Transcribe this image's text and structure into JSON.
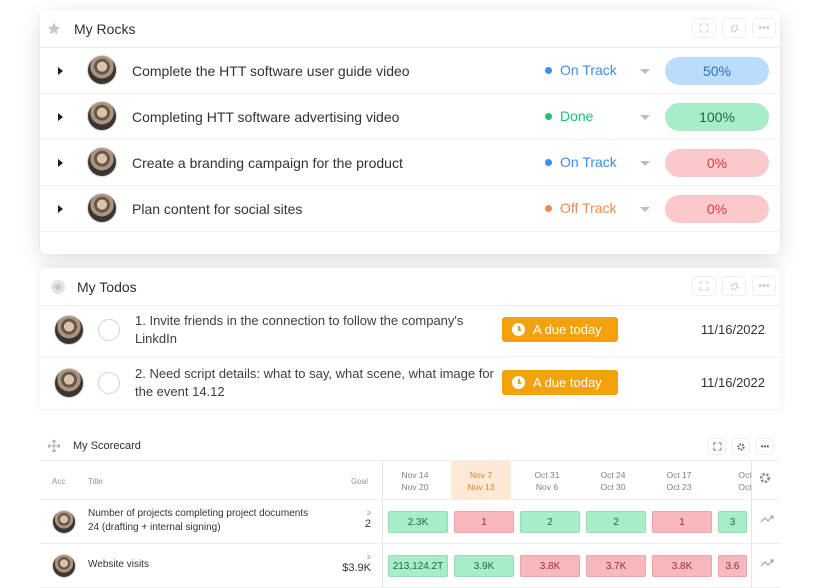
{
  "rocks": {
    "title": "My Rocks",
    "rows": [
      {
        "title": "Complete the HTT software user guide video",
        "status": "On Track",
        "status_color": "#3b8ff0",
        "progress": "50%",
        "pill_bg": "#bcdcfb",
        "pill_fg": "#2a6fc4"
      },
      {
        "title": "Completing HTT software advertising video",
        "status": "Done",
        "status_color": "#16c472",
        "progress": "100%",
        "pill_bg": "#a9ecc8",
        "pill_fg": "#1d6a45"
      },
      {
        "title": "Create a branding campaign for the product",
        "status": "On Track",
        "status_color": "#3b8ff0",
        "progress": "0%",
        "pill_bg": "#fbc9cc",
        "pill_fg": "#d83a45"
      },
      {
        "title": "Plan content for social sites",
        "status": "Off Track",
        "status_color": "#f08a4b",
        "progress": "0%",
        "pill_bg": "#fbc9cc",
        "pill_fg": "#d83a45"
      }
    ]
  },
  "todos": {
    "title": "My Todos",
    "rows": [
      {
        "text": "1. Invite friends in the connection to follow the company's LinkdIn",
        "badge": "A due today",
        "date": "11/16/2022"
      },
      {
        "text": "2. Need script details: what to say, what scene, what image for the event 14.12",
        "badge": "A due today",
        "date": "11/16/2022"
      }
    ]
  },
  "scorecard": {
    "title": "My Scorecard",
    "headers": {
      "acc": "Acc",
      "title": "Title",
      "goal": "Goal"
    },
    "weeks": [
      {
        "a": "Nov 14",
        "b": "Nov 20",
        "current": false
      },
      {
        "a": "Nov 7",
        "b": "Nov 13",
        "current": true
      },
      {
        "a": "Oct 31",
        "b": "Nov 6",
        "current": false
      },
      {
        "a": "Oct 24",
        "b": "Oct 30",
        "current": false
      },
      {
        "a": "Oct 17",
        "b": "Oct 23",
        "current": false
      },
      {
        "a": "Oct",
        "b": "Oct",
        "current": false
      }
    ],
    "rows": [
      {
        "title": "Number of projects completing project documents 24 (drafting + internal signing)",
        "goal_op": "≥",
        "goal": "2",
        "cells": [
          {
            "v": "2.3K",
            "c": "green"
          },
          {
            "v": "1",
            "c": "red"
          },
          {
            "v": "2",
            "c": "green"
          },
          {
            "v": "2",
            "c": "green"
          },
          {
            "v": "1",
            "c": "red"
          },
          {
            "v": "3",
            "c": "green"
          }
        ]
      },
      {
        "title": "Website visits",
        "goal_op": "≥",
        "goal": "$3.9K",
        "cells": [
          {
            "v": "213,124.2T",
            "c": "green"
          },
          {
            "v": "3.9K",
            "c": "green"
          },
          {
            "v": "3.8K",
            "c": "red"
          },
          {
            "v": "3.7K",
            "c": "red"
          },
          {
            "v": "3.8K",
            "c": "red"
          },
          {
            "v": "3.6",
            "c": "red"
          }
        ]
      }
    ]
  }
}
